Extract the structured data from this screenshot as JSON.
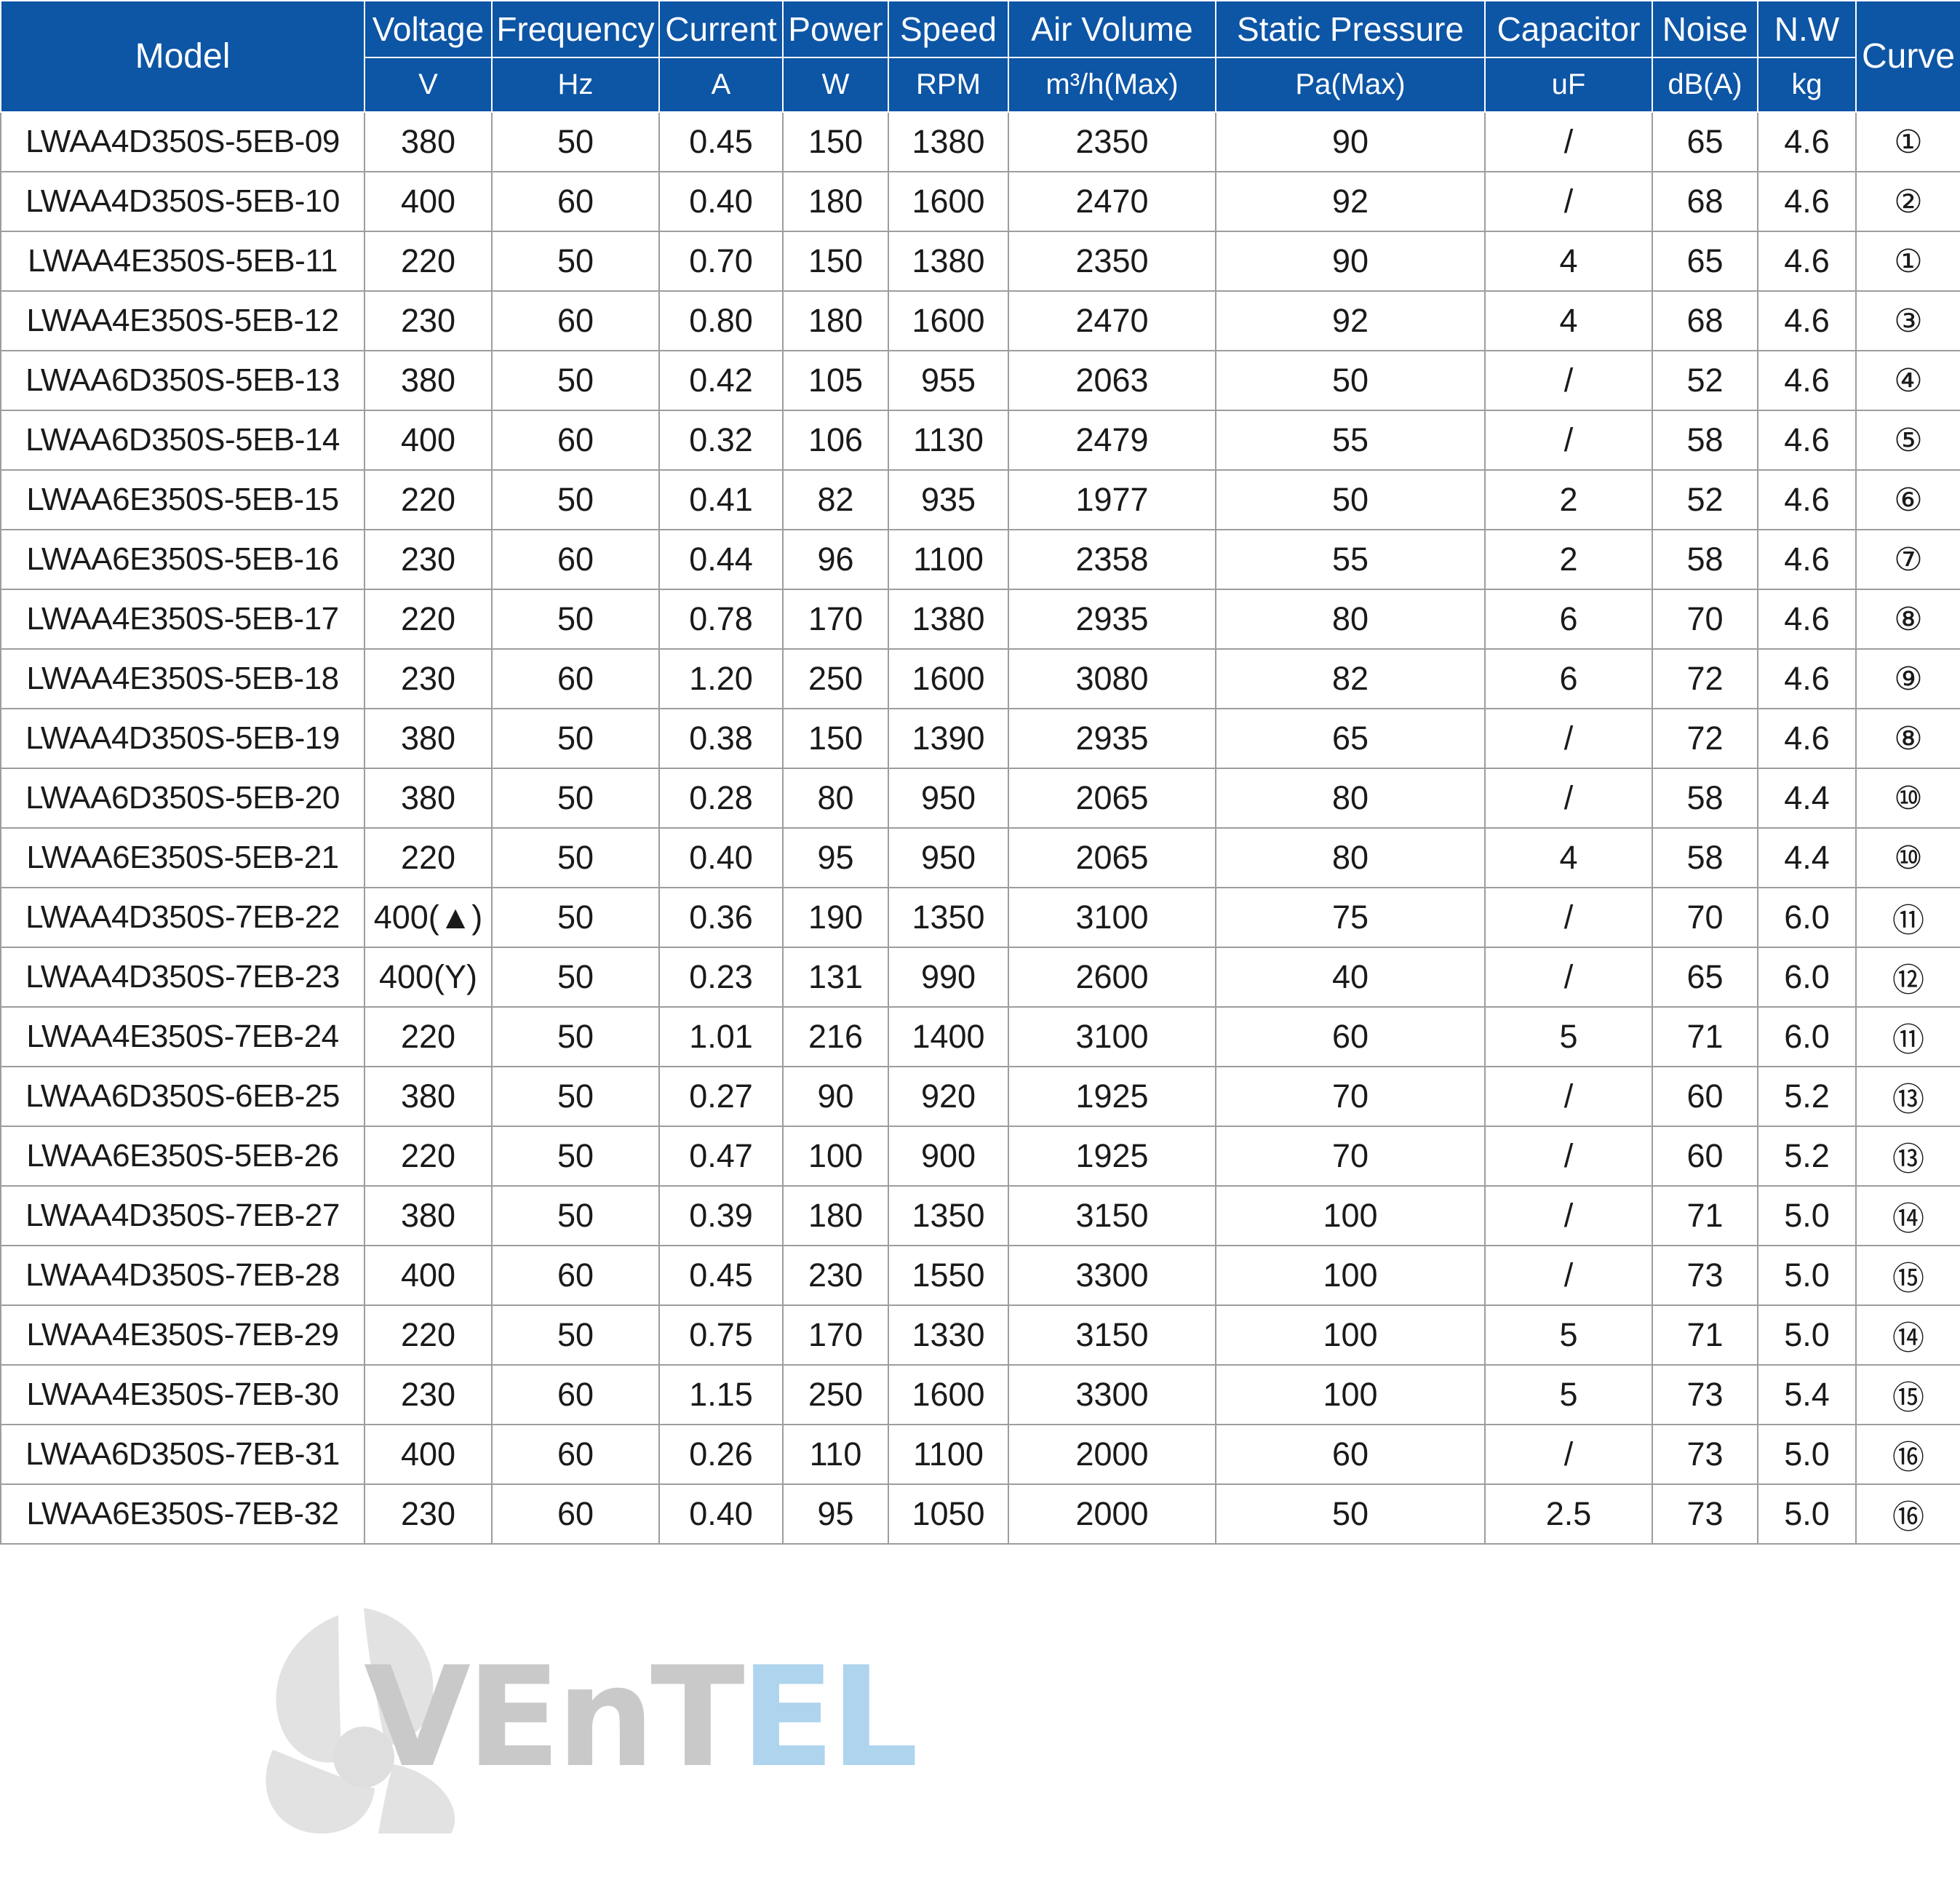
{
  "table": {
    "headers": {
      "model": "Model",
      "groups": [
        {
          "label": "Voltage",
          "unit": "V"
        },
        {
          "label": "Frequency",
          "unit": "Hz"
        },
        {
          "label": "Current",
          "unit": "A"
        },
        {
          "label": "Power",
          "unit": "W"
        },
        {
          "label": "Speed",
          "unit": "RPM"
        },
        {
          "label": "Air Volume",
          "unit": "m³/h(Max)"
        },
        {
          "label": "Static Pressure",
          "unit": "Pa(Max)"
        },
        {
          "label": "Capacitor",
          "unit": "uF"
        },
        {
          "label": "Noise",
          "unit": "dB(A)"
        },
        {
          "label": "N.W",
          "unit": "kg"
        }
      ],
      "curve": "Curve"
    },
    "rows": [
      {
        "model": "LWAA4D350S-5EB-09",
        "voltage": "380",
        "frequency": "50",
        "current": "0.45",
        "power": "150",
        "speed": "1380",
        "air_volume": "2350",
        "static_pressure": "90",
        "capacitor": "/",
        "noise": "65",
        "weight": "4.6",
        "curve": "①"
      },
      {
        "model": "LWAA4D350S-5EB-10",
        "voltage": "400",
        "frequency": "60",
        "current": "0.40",
        "power": "180",
        "speed": "1600",
        "air_volume": "2470",
        "static_pressure": "92",
        "capacitor": "/",
        "noise": "68",
        "weight": "4.6",
        "curve": "②"
      },
      {
        "model": "LWAA4E350S-5EB-11",
        "voltage": "220",
        "frequency": "50",
        "current": "0.70",
        "power": "150",
        "speed": "1380",
        "air_volume": "2350",
        "static_pressure": "90",
        "capacitor": "4",
        "noise": "65",
        "weight": "4.6",
        "curve": "①"
      },
      {
        "model": "LWAA4E350S-5EB-12",
        "voltage": "230",
        "frequency": "60",
        "current": "0.80",
        "power": "180",
        "speed": "1600",
        "air_volume": "2470",
        "static_pressure": "92",
        "capacitor": "4",
        "noise": "68",
        "weight": "4.6",
        "curve": "③"
      },
      {
        "model": "LWAA6D350S-5EB-13",
        "voltage": "380",
        "frequency": "50",
        "current": "0.42",
        "power": "105",
        "speed": "955",
        "air_volume": "2063",
        "static_pressure": "50",
        "capacitor": "/",
        "noise": "52",
        "weight": "4.6",
        "curve": "④"
      },
      {
        "model": "LWAA6D350S-5EB-14",
        "voltage": "400",
        "frequency": "60",
        "current": "0.32",
        "power": "106",
        "speed": "1130",
        "air_volume": "2479",
        "static_pressure": "55",
        "capacitor": "/",
        "noise": "58",
        "weight": "4.6",
        "curve": "⑤"
      },
      {
        "model": "LWAA6E350S-5EB-15",
        "voltage": "220",
        "frequency": "50",
        "current": "0.41",
        "power": "82",
        "speed": "935",
        "air_volume": "1977",
        "static_pressure": "50",
        "capacitor": "2",
        "noise": "52",
        "weight": "4.6",
        "curve": "⑥"
      },
      {
        "model": "LWAA6E350S-5EB-16",
        "voltage": "230",
        "frequency": "60",
        "current": "0.44",
        "power": "96",
        "speed": "1100",
        "air_volume": "2358",
        "static_pressure": "55",
        "capacitor": "2",
        "noise": "58",
        "weight": "4.6",
        "curve": "⑦"
      },
      {
        "model": "LWAA4E350S-5EB-17",
        "voltage": "220",
        "frequency": "50",
        "current": "0.78",
        "power": "170",
        "speed": "1380",
        "air_volume": "2935",
        "static_pressure": "80",
        "capacitor": "6",
        "noise": "70",
        "weight": "4.6",
        "curve": "⑧"
      },
      {
        "model": "LWAA4E350S-5EB-18",
        "voltage": "230",
        "frequency": "60",
        "current": "1.20",
        "power": "250",
        "speed": "1600",
        "air_volume": "3080",
        "static_pressure": "82",
        "capacitor": "6",
        "noise": "72",
        "weight": "4.6",
        "curve": "⑨"
      },
      {
        "model": "LWAA4D350S-5EB-19",
        "voltage": "380",
        "frequency": "50",
        "current": "0.38",
        "power": "150",
        "speed": "1390",
        "air_volume": "2935",
        "static_pressure": "65",
        "capacitor": "/",
        "noise": "72",
        "weight": "4.6",
        "curve": "⑧"
      },
      {
        "model": "LWAA6D350S-5EB-20",
        "voltage": "380",
        "frequency": "50",
        "current": "0.28",
        "power": "80",
        "speed": "950",
        "air_volume": "2065",
        "static_pressure": "80",
        "capacitor": "/",
        "noise": "58",
        "weight": "4.4",
        "curve": "⑩"
      },
      {
        "model": "LWAA6E350S-5EB-21",
        "voltage": "220",
        "frequency": "50",
        "current": "0.40",
        "power": "95",
        "speed": "950",
        "air_volume": "2065",
        "static_pressure": "80",
        "capacitor": "4",
        "noise": "58",
        "weight": "4.4",
        "curve": "⑩"
      },
      {
        "model": "LWAA4D350S-7EB-22",
        "voltage": "400(▲)",
        "frequency": "50",
        "current": "0.36",
        "power": "190",
        "speed": "1350",
        "air_volume": "3100",
        "static_pressure": "75",
        "capacitor": "/",
        "noise": "70",
        "weight": "6.0",
        "curve": "⑪"
      },
      {
        "model": "LWAA4D350S-7EB-23",
        "voltage": "400(Y)",
        "frequency": "50",
        "current": "0.23",
        "power": "131",
        "speed": "990",
        "air_volume": "2600",
        "static_pressure": "40",
        "capacitor": "/",
        "noise": "65",
        "weight": "6.0",
        "curve": "⑫"
      },
      {
        "model": "LWAA4E350S-7EB-24",
        "voltage": "220",
        "frequency": "50",
        "current": "1.01",
        "power": "216",
        "speed": "1400",
        "air_volume": "3100",
        "static_pressure": "60",
        "capacitor": "5",
        "noise": "71",
        "weight": "6.0",
        "curve": "⑪"
      },
      {
        "model": "LWAA6D350S-6EB-25",
        "voltage": "380",
        "frequency": "50",
        "current": "0.27",
        "power": "90",
        "speed": "920",
        "air_volume": "1925",
        "static_pressure": "70",
        "capacitor": "/",
        "noise": "60",
        "weight": "5.2",
        "curve": "⑬"
      },
      {
        "model": "LWAA6E350S-5EB-26",
        "voltage": "220",
        "frequency": "50",
        "current": "0.47",
        "power": "100",
        "speed": "900",
        "air_volume": "1925",
        "static_pressure": "70",
        "capacitor": "/",
        "noise": "60",
        "weight": "5.2",
        "curve": "⑬"
      },
      {
        "model": "LWAA4D350S-7EB-27",
        "voltage": "380",
        "frequency": "50",
        "current": "0.39",
        "power": "180",
        "speed": "1350",
        "air_volume": "3150",
        "static_pressure": "100",
        "capacitor": "/",
        "noise": "71",
        "weight": "5.0",
        "curve": "⑭"
      },
      {
        "model": "LWAA4D350S-7EB-28",
        "voltage": "400",
        "frequency": "60",
        "current": "0.45",
        "power": "230",
        "speed": "1550",
        "air_volume": "3300",
        "static_pressure": "100",
        "capacitor": "/",
        "noise": "73",
        "weight": "5.0",
        "curve": "⑮"
      },
      {
        "model": "LWAA4E350S-7EB-29",
        "voltage": "220",
        "frequency": "50",
        "current": "0.75",
        "power": "170",
        "speed": "1330",
        "air_volume": "3150",
        "static_pressure": "100",
        "capacitor": "5",
        "noise": "71",
        "weight": "5.0",
        "curve": "⑭"
      },
      {
        "model": "LWAA4E350S-7EB-30",
        "voltage": "230",
        "frequency": "60",
        "current": "1.15",
        "power": "250",
        "speed": "1600",
        "air_volume": "3300",
        "static_pressure": "100",
        "capacitor": "5",
        "noise": "73",
        "weight": "5.4",
        "curve": "⑮"
      },
      {
        "model": "LWAA6D350S-7EB-31",
        "voltage": "400",
        "frequency": "60",
        "current": "0.26",
        "power": "110",
        "speed": "1100",
        "air_volume": "2000",
        "static_pressure": "60",
        "capacitor": "/",
        "noise": "73",
        "weight": "5.0",
        "curve": "⑯"
      },
      {
        "model": "LWAA6E350S-7EB-32",
        "voltage": "230",
        "frequency": "60",
        "current": "0.40",
        "power": "95",
        "speed": "1050",
        "air_volume": "2000",
        "static_pressure": "50",
        "capacitor": "2.5",
        "noise": "73",
        "weight": "5.0",
        "curve": "⑯"
      }
    ]
  },
  "watermark": {
    "text_a": "VEnT",
    "text_b": "EL",
    "color_a": "#c9c9c9",
    "color_b": "#aed4ee"
  },
  "colors": {
    "header_background": "#0d55a5",
    "header_text": "#ffffff",
    "grid_line": "#9d9d9d",
    "body_text": "#1a1a1a",
    "page_background": "#ffffff"
  }
}
